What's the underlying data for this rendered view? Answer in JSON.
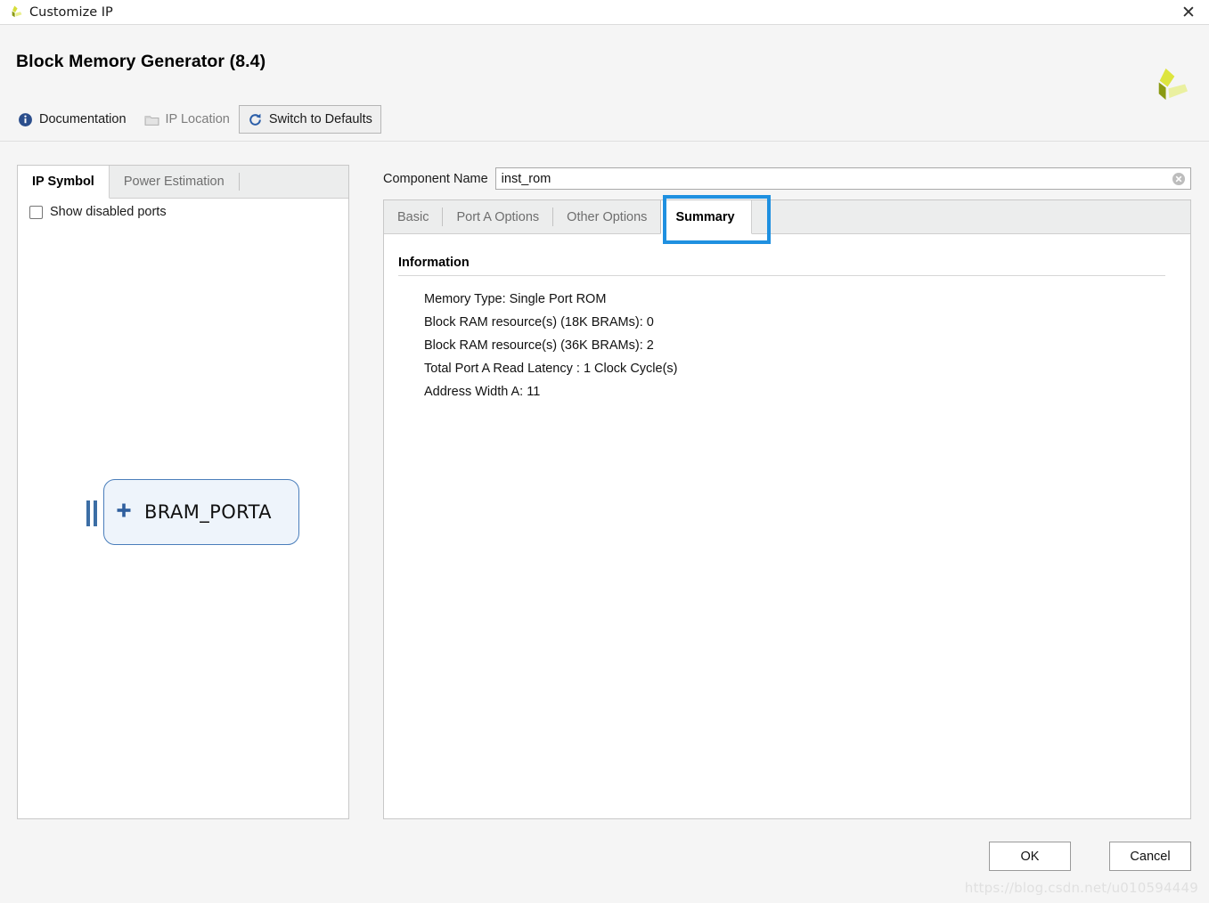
{
  "window": {
    "title": "Customize IP",
    "icon": "xilinx-logo-icon",
    "close_label": "✕"
  },
  "header": {
    "ip_title": "Block Memory Generator (8.4)",
    "brand_icon": "xilinx-logo-icon",
    "toolbar": [
      {
        "label": "Documentation",
        "icon": "info-icon",
        "state": "enabled"
      },
      {
        "label": "IP Location",
        "icon": "folder-icon",
        "state": "disabled"
      },
      {
        "label": "Switch to Defaults",
        "icon": "refresh-icon",
        "state": "enabled"
      }
    ]
  },
  "left_panel": {
    "tabs": [
      {
        "label": "IP Symbol",
        "active": true
      },
      {
        "label": "Power Estimation",
        "active": false
      }
    ],
    "show_disabled_ports": {
      "label": "Show disabled ports",
      "checked": false
    },
    "symbol": {
      "expander": "+",
      "label": "BRAM_PORTA",
      "port_bars": 2
    }
  },
  "component_name": {
    "label": "Component Name",
    "value": "inst_rom",
    "placeholder": "",
    "clear_icon": "clear-circle-icon"
  },
  "right_panel": {
    "tabs": [
      {
        "label": "Basic",
        "active": false
      },
      {
        "label": "Port A Options",
        "active": false
      },
      {
        "label": "Other Options",
        "active": false
      },
      {
        "label": "Summary",
        "active": true
      }
    ],
    "highlight_color": "#1f90e0",
    "information": {
      "heading": "Information",
      "lines": [
        "Memory Type: Single Port ROM",
        "Block RAM resource(s) (18K BRAMs): 0",
        "Block RAM resource(s) (36K BRAMs): 2",
        "Total Port A Read Latency : 1 Clock Cycle(s)",
        "Address Width A: 11"
      ]
    }
  },
  "footer": {
    "ok_label": "OK",
    "cancel_label": "Cancel"
  },
  "watermark": "https://blog.csdn.net/u010594449"
}
